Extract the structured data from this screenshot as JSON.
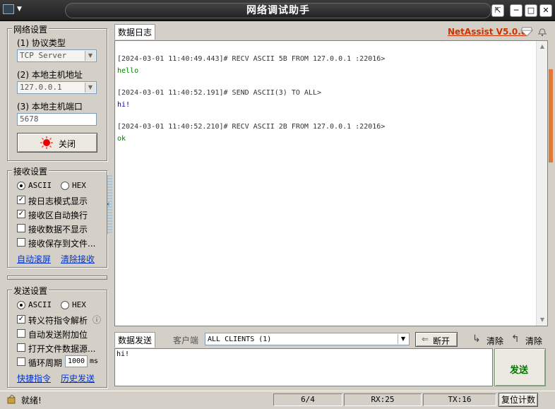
{
  "window": {
    "title": "网络调试助手",
    "system_menu_caret": "▼",
    "buttons": {
      "pin": "⇱",
      "minimize": "─",
      "maximize": "□",
      "close": "✕"
    }
  },
  "network": {
    "group_title": "网络设置",
    "protocol_label": "(1) 协议类型",
    "protocol_value": "TCP Server",
    "host_label": "(2) 本地主机地址",
    "host_value": "127.0.0.1",
    "port_label": "(3) 本地主机端口",
    "port_value": "5678",
    "close_button": "关闭"
  },
  "receive": {
    "group_title": "接收设置",
    "ascii": "ASCII",
    "hex": "HEX",
    "options": [
      {
        "label": "按日志模式显示",
        "checked": true
      },
      {
        "label": "接收区自动换行",
        "checked": true
      },
      {
        "label": "接收数据不显示",
        "checked": false
      },
      {
        "label": "接收保存到文件...",
        "checked": false
      }
    ],
    "link_autoscroll": "自动滚屏",
    "link_clear": "清除接收"
  },
  "send": {
    "group_title": "发送设置",
    "ascii": "ASCII",
    "hex": "HEX",
    "options": [
      {
        "label": "转义符指令解析",
        "checked": true
      },
      {
        "label": "自动发送附加位",
        "checked": false
      },
      {
        "label": "打开文件数据源...",
        "checked": false
      },
      {
        "label": "循环周期",
        "checked": false
      }
    ],
    "period_value": "1000",
    "period_unit": "ms",
    "info_icon": "ⓘ",
    "link_shortcuts": "快捷指令",
    "link_history": "历史发送"
  },
  "log": {
    "tab_label": "数据日志",
    "brand": "NetAssist V5.0.8",
    "lines": [
      {
        "text": "[2024-03-01 11:40:49.443]# RECV ASCII 5B FROM 127.0.0.1 :22016>",
        "color": "#333333"
      },
      {
        "text": "hello",
        "color": "#008000"
      },
      {
        "text": "[2024-03-01 11:40:52.191]# SEND ASCII(3) TO ALL>",
        "color": "#333333"
      },
      {
        "text": "hi!",
        "color": "#000099"
      },
      {
        "text": "[2024-03-01 11:40:52.210]# RECV ASCII 2B FROM 127.0.0.1 :22016>",
        "color": "#333333"
      },
      {
        "text": "ok",
        "color": "#008000"
      }
    ]
  },
  "sendbar": {
    "tab_label": "数据发送",
    "client_label": "客户端",
    "client_value": "ALL CLIENTS (1)",
    "disconnect": "断开",
    "clear1": "清除",
    "clear2": "清除",
    "input_value": "hi!",
    "send_button": "发送"
  },
  "status": {
    "text": "就绪!",
    "count": "6/4",
    "rx": "RX:25",
    "tx": "TX:16",
    "reset": "复位计数"
  },
  "colors": {
    "brand": "#cc3300",
    "send_green": "#007700",
    "scroll_accent": "#e07a3a"
  }
}
